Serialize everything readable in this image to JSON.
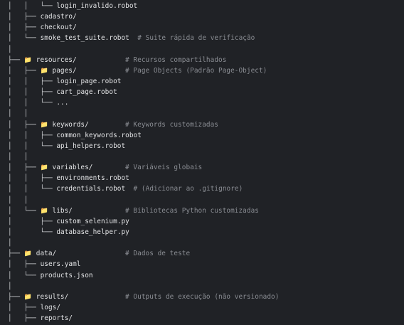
{
  "lines": [
    {
      "prefix": "│   │   └── ",
      "icon": "",
      "name": "login_invalido.robot",
      "comment": ""
    },
    {
      "prefix": "│   ├── ",
      "icon": "",
      "name": "cadastro/",
      "comment": ""
    },
    {
      "prefix": "│   ├── ",
      "icon": "",
      "name": "checkout/",
      "comment": ""
    },
    {
      "prefix": "│   └── ",
      "icon": "",
      "name": "smoke_test_suite.robot",
      "comment": "# Suite rápida de verificação"
    },
    {
      "prefix": "│",
      "icon": "",
      "name": "",
      "comment": ""
    },
    {
      "prefix": "├── ",
      "icon": "folder-icon",
      "name": "resources/",
      "comment": "# Recursos compartilhados"
    },
    {
      "prefix": "│   ├── ",
      "icon": "folder-icon",
      "name": "pages/",
      "comment": "# Page Objects (Padrão Page-Object)"
    },
    {
      "prefix": "│   │   ├── ",
      "icon": "",
      "name": "login_page.robot",
      "comment": ""
    },
    {
      "prefix": "│   │   ├── ",
      "icon": "",
      "name": "cart_page.robot",
      "comment": ""
    },
    {
      "prefix": "│   │   └── ",
      "icon": "",
      "name": "...",
      "comment": ""
    },
    {
      "prefix": "│   │",
      "icon": "",
      "name": "",
      "comment": ""
    },
    {
      "prefix": "│   ├── ",
      "icon": "folder-icon",
      "name": "keywords/",
      "comment": "# Keywords customizadas"
    },
    {
      "prefix": "│   │   ├── ",
      "icon": "",
      "name": "common_keywords.robot",
      "comment": ""
    },
    {
      "prefix": "│   │   └── ",
      "icon": "",
      "name": "api_helpers.robot",
      "comment": ""
    },
    {
      "prefix": "│   │",
      "icon": "",
      "name": "",
      "comment": ""
    },
    {
      "prefix": "│   ├── ",
      "icon": "folder-icon",
      "name": "variables/",
      "comment": "# Variáveis globais"
    },
    {
      "prefix": "│   │   ├── ",
      "icon": "",
      "name": "environments.robot",
      "comment": ""
    },
    {
      "prefix": "│   │   └── ",
      "icon": "",
      "name": "credentials.robot",
      "comment": "# (Adicionar ao .gitignore)"
    },
    {
      "prefix": "│   │",
      "icon": "",
      "name": "",
      "comment": ""
    },
    {
      "prefix": "│   └── ",
      "icon": "folder-icon",
      "name": "libs/",
      "comment": "# Bibliotecas Python customizadas"
    },
    {
      "prefix": "│       ├── ",
      "icon": "",
      "name": "custom_selenium.py",
      "comment": ""
    },
    {
      "prefix": "│       └── ",
      "icon": "",
      "name": "database_helper.py",
      "comment": ""
    },
    {
      "prefix": "│",
      "icon": "",
      "name": "",
      "comment": ""
    },
    {
      "prefix": "├── ",
      "icon": "folder-icon",
      "name": "data/",
      "comment": "# Dados de teste"
    },
    {
      "prefix": "│   ├── ",
      "icon": "",
      "name": "users.yaml",
      "comment": ""
    },
    {
      "prefix": "│   └── ",
      "icon": "",
      "name": "products.json",
      "comment": ""
    },
    {
      "prefix": "│",
      "icon": "",
      "name": "",
      "comment": ""
    },
    {
      "prefix": "├── ",
      "icon": "folder-icon",
      "name": "results/",
      "comment": "# Outputs de execução (não versionado)"
    },
    {
      "prefix": "│   ├── ",
      "icon": "",
      "name": "logs/",
      "comment": ""
    },
    {
      "prefix": "│   ├── ",
      "icon": "",
      "name": "reports/",
      "comment": ""
    }
  ]
}
